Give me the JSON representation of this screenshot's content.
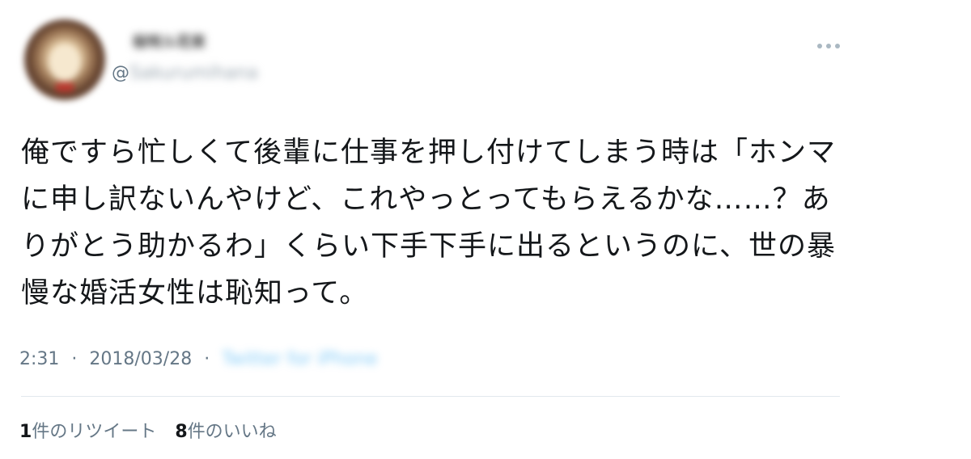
{
  "user": {
    "display_name": "桜咲ル花束",
    "handle_prefix": "@",
    "handle": "Sakurumihana"
  },
  "tweet": {
    "text": "俺ですら忙しくて後輩に仕事を押し付けてしまう時は「ホンマに申し訳ないんやけど、これやっとってもらえるかな……？ありがとう助かるわ」くらい下手下手に出るというのに、世の暴慢な婚活女性は恥知って。"
  },
  "meta": {
    "time": "2:31",
    "date": "2018/03/28",
    "separator": "·",
    "source": "Twitter for iPhone"
  },
  "stats": {
    "retweets_count": "1",
    "retweets_label": "件のリツイート",
    "likes_count": "8",
    "likes_label": "件のいいね"
  },
  "icons": {
    "more": "more-dots-icon"
  },
  "colors": {
    "meta_text": "#657786",
    "link_blue": "#1da1f2",
    "divider": "#e1e8ed"
  }
}
